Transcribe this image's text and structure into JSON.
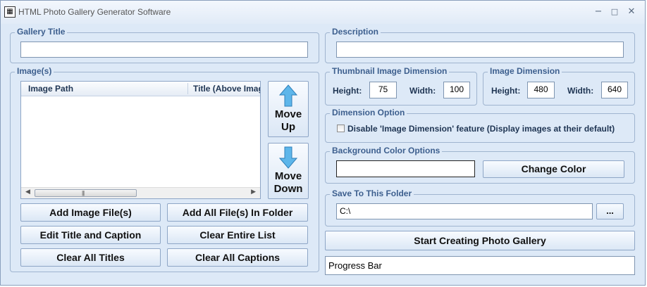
{
  "window": {
    "title": "HTML Photo Gallery Generator Software",
    "minimize": "−",
    "maximize": "□",
    "close": "✕"
  },
  "gallery_title": {
    "legend": "Gallery Title",
    "value": ""
  },
  "description": {
    "legend": "Description",
    "value": ""
  },
  "images": {
    "legend": "Image(s)",
    "columns": [
      "Image Path",
      "Title (Above Image)"
    ],
    "rows": [],
    "move_up": [
      "Move",
      "Up"
    ],
    "move_down": [
      "Move",
      "Down"
    ]
  },
  "buttons": {
    "add_image_files": "Add Image File(s)",
    "add_all_files_in_folder": "Add All File(s) In Folder",
    "edit_title_caption": "Edit Title and Caption",
    "clear_entire_list": "Clear Entire List",
    "clear_all_titles": "Clear All Titles",
    "clear_all_captions": "Clear All Captions",
    "change_color": "Change Color",
    "browse": "...",
    "start": "Start Creating Photo Gallery"
  },
  "thumbnail_dimension": {
    "legend": "Thumbnail Image Dimension",
    "height_label": "Height:",
    "height": "75",
    "width_label": "Width:",
    "width": "100"
  },
  "image_dimension": {
    "legend": "Image Dimension",
    "height_label": "Height:",
    "height": "480",
    "width_label": "Width:",
    "width": "640"
  },
  "dimension_option": {
    "legend": "Dimension Option",
    "checkbox_label": "Disable 'Image Dimension' feature (Display images at their default)",
    "checked": false
  },
  "background_color": {
    "legend": "Background Color Options",
    "value": "#ffffff"
  },
  "save_folder": {
    "legend": "Save To This Folder",
    "value": "C:\\"
  },
  "progress": {
    "label": "Progress Bar"
  }
}
